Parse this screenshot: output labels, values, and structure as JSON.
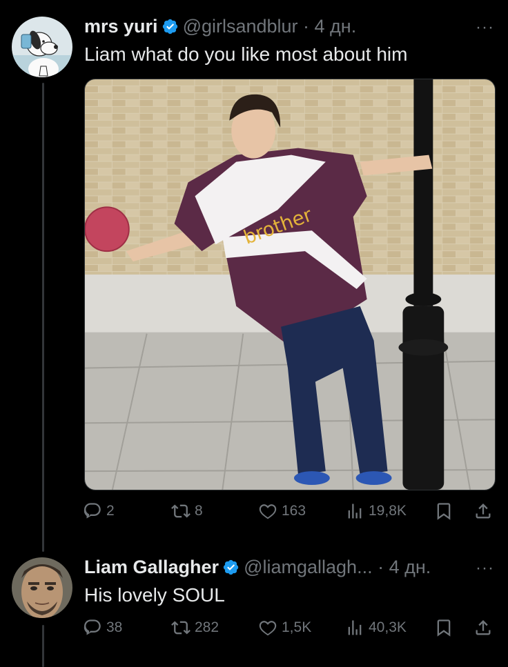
{
  "colors": {
    "background": "#000000",
    "text": "#e7e9ea",
    "muted": "#71767b",
    "verified": "#1d9bf0",
    "thread_line": "#333639"
  },
  "tweets": [
    {
      "display_name": "mrs yuri",
      "handle_time": "@girlsandblur · 4 дн.",
      "text": "Liam what do you like most about him",
      "avatar_icon": "snoopy-avatar",
      "media_icon": "photo-man-football-kit",
      "stats": {
        "replies": "2",
        "retweets": "8",
        "likes": "163",
        "views": "19,8K"
      }
    },
    {
      "display_name": "Liam Gallagher",
      "handle_time": "@liamgallagh... · 4 дн.",
      "text": "His lovely SOUL",
      "avatar_icon": "profile-photo-avatar",
      "stats": {
        "replies": "38",
        "retweets": "282",
        "likes": "1,5K",
        "views": "40,3K"
      }
    }
  ],
  "more_label": "···"
}
